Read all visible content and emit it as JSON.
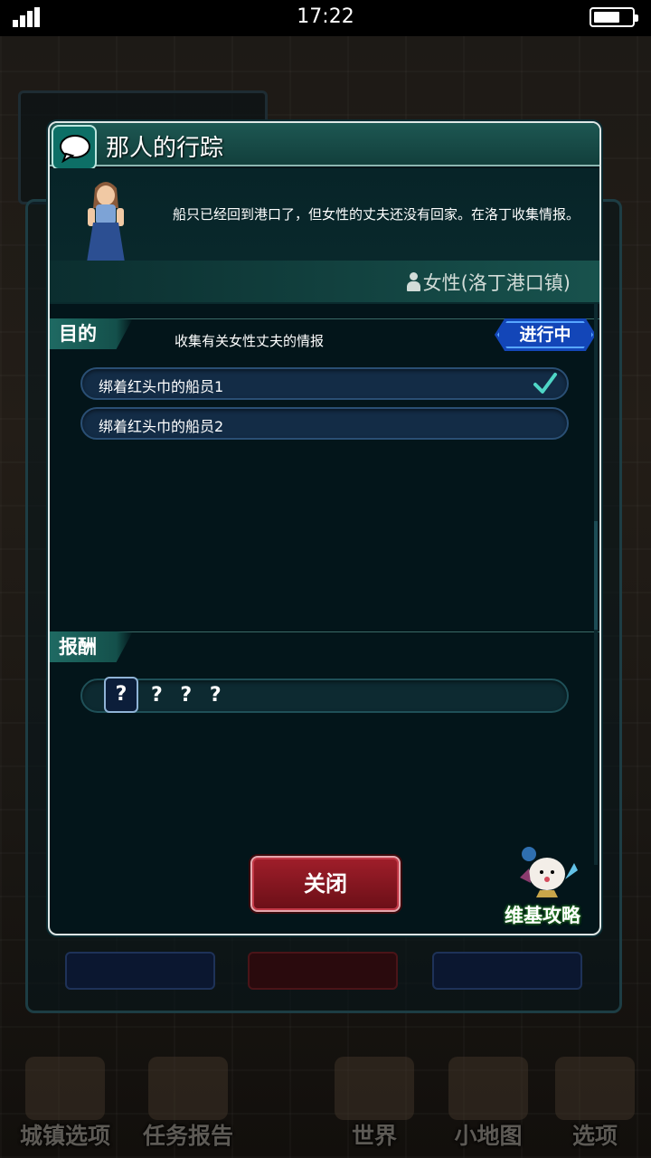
{
  "status_bar": {
    "time": "17:22"
  },
  "dialog": {
    "title": "那人的行踪",
    "icon": "chat-bubble-icon",
    "npc": {
      "description": "船只已经回到港口了，但女性的丈夫还没有回家。在洛丁收集情报。",
      "location": "女性(洛丁港口镇)"
    },
    "objective": {
      "header": "目的",
      "text": "收集有关女性丈夫的情报",
      "status": "进行中",
      "items": [
        {
          "label": "绑着红头巾的船员1",
          "done": true
        },
        {
          "label": "绑着红头巾的船员2",
          "done": false
        }
      ]
    },
    "reward": {
      "header": "报酬",
      "icon_text": "?",
      "text": "? ? ?"
    },
    "close_label": "关闭"
  },
  "wiki": {
    "label": "维基攻略"
  },
  "bottom_nav": [
    {
      "label": "城镇选项"
    },
    {
      "label": "任务报告"
    },
    {
      "label": "世界"
    },
    {
      "label": "小地图"
    },
    {
      "label": "选项"
    }
  ],
  "colors": {
    "dialog_bg": "#03151a",
    "teal_accent": "#1f6a63",
    "status_blue": "#1346b8",
    "close_red": "#a01e2a",
    "check_teal": "#4fd6c6"
  }
}
